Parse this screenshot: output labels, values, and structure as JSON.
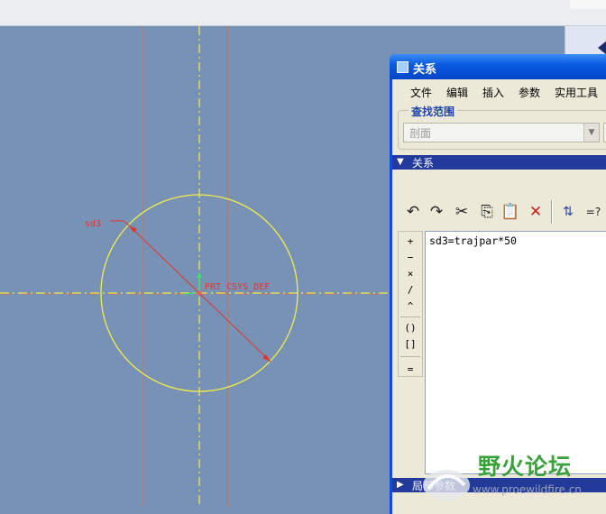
{
  "canvas": {
    "dimension_label": "sd3",
    "csys_label": "PRT_CSYS_DEF"
  },
  "dialog": {
    "title": "关系",
    "menus": [
      "文件",
      "编辑",
      "插入",
      "参数",
      "实用工具"
    ],
    "scope_group_label": "查找范围",
    "scope_value": "剖面",
    "relations_header": "关系",
    "toolbar": [
      {
        "name": "undo-icon",
        "glyph": "↶"
      },
      {
        "name": "redo-icon",
        "glyph": "↷"
      },
      {
        "name": "cut-icon",
        "glyph": "✂"
      },
      {
        "name": "copy-icon",
        "glyph": "⎘"
      },
      {
        "name": "paste-icon",
        "glyph": "📋"
      },
      {
        "name": "delete-icon",
        "glyph": "✕"
      },
      {
        "name": "sort-relations-icon",
        "glyph": "⇅"
      },
      {
        "name": "evaluate-icon",
        "glyph": "=?"
      }
    ],
    "operators": [
      "+",
      "−",
      "×",
      "/",
      "^",
      "()",
      "[]",
      "="
    ],
    "relation_text": "sd3=trajpar*50",
    "local_params_header": "局部参数"
  },
  "watermark": {
    "brand": "野火论坛",
    "url": "www.proewildfire.cn"
  },
  "colors": {
    "sketch_background": "#7892b5",
    "circle": "#f2ee4a",
    "dimension": "#e2352b",
    "title_bar": "#0658e0",
    "section_bar": "#233a9b"
  }
}
